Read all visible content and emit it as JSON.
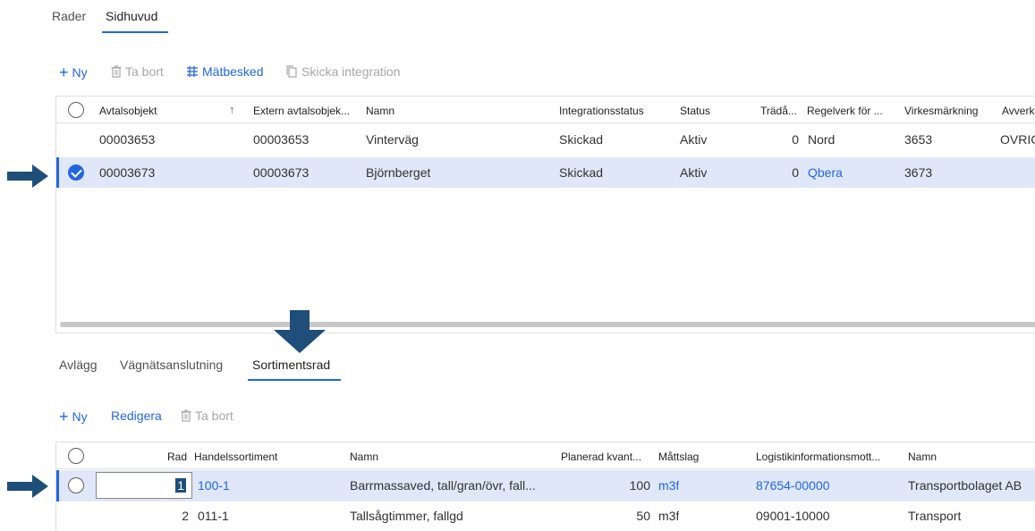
{
  "top_tabs": [
    {
      "label": "Rader",
      "active": false
    },
    {
      "label": "Sidhuvud",
      "active": true
    }
  ],
  "top_toolbar": {
    "new_label": "Ny",
    "delete_label": "Ta bort",
    "measure_label": "Mätbesked",
    "send_integration_label": "Skicka integration"
  },
  "top_grid": {
    "columns": [
      "Avtalsobjekt",
      "Extern avtalsobjek...",
      "Namn",
      "Integrationsstatus",
      "Status",
      "Trädå...",
      "Regelverk för ...",
      "Virkesmärkning",
      "Avverk"
    ],
    "sort_indicator": "↑",
    "rows": [
      {
        "avtalsobjekt": "00003653",
        "extern": "00003653",
        "namn": "Vinterväg",
        "integrationsstatus": "Skickad",
        "status": "Aktiv",
        "trada": "0",
        "regelverk": "Nord",
        "virkesmarkning": "3653",
        "avverk": "OVRIG",
        "selected": false
      },
      {
        "avtalsobjekt": "00003673",
        "extern": "00003673",
        "namn": "Björnberget",
        "integrationsstatus": "Skickad",
        "status": "Aktiv",
        "trada": "0",
        "regelverk": "Qbera",
        "virkesmarkning": "3673",
        "avverk": "",
        "selected": true
      }
    ]
  },
  "bottom_tabs": [
    {
      "label": "Avlägg",
      "active": false
    },
    {
      "label": "Vägnätsanslutning",
      "active": false
    },
    {
      "label": "Sortimentsrad",
      "active": true
    }
  ],
  "bottom_toolbar": {
    "new_label": "Ny",
    "edit_label": "Redigera",
    "delete_label": "Ta bort"
  },
  "bottom_grid": {
    "columns": [
      "Rad",
      "Handelssortiment",
      "Namn",
      "Planerad kvant...",
      "Måttslag",
      "Logistikinformationsmott...",
      "Namn"
    ],
    "rows": [
      {
        "rad": "1",
        "handelssortiment": "100-1",
        "namn": "Barrmassaved, tall/gran/övr, fall...",
        "planerad": "100",
        "mattslag": "m3f",
        "logistik": "87654-00000",
        "namn2": "Transportbolaget AB",
        "selected": true
      },
      {
        "rad": "2",
        "handelssortiment": "011-1",
        "namn": "Tallsågtimmer, fallgd",
        "planerad": "50",
        "mattslag": "m3f",
        "logistik": "09001-10000",
        "namn2": "Transport",
        "selected": false
      }
    ]
  },
  "colors": {
    "accent": "#2266e3",
    "selected_row": "#dfe7f8",
    "annotation_arrow": "#1f4e79"
  }
}
